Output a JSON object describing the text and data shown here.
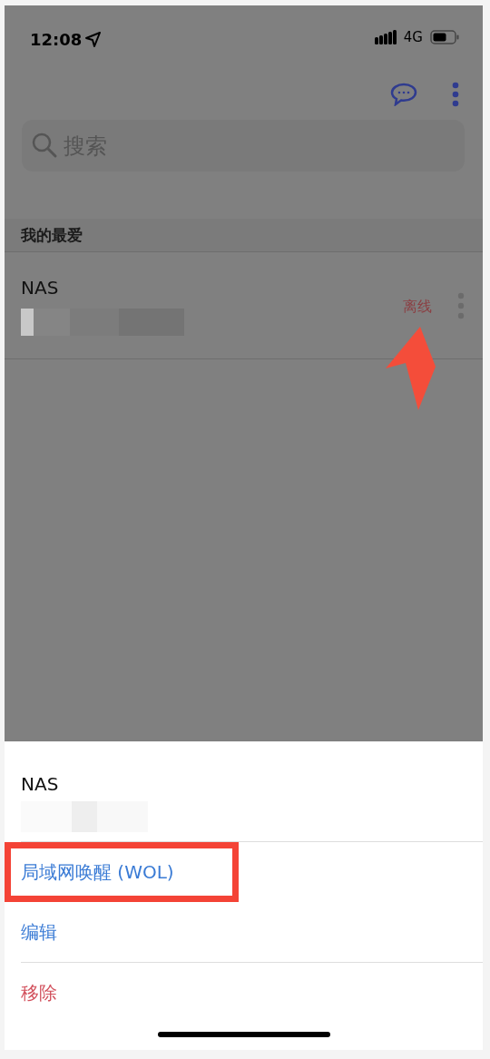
{
  "status_bar": {
    "time": "12:08",
    "network": "4G"
  },
  "search": {
    "placeholder": "搜索"
  },
  "section": {
    "title": "我的最爱"
  },
  "devices": [
    {
      "name": "NAS",
      "status": "离线",
      "status_arrow": true
    }
  ],
  "sheet": {
    "title": "NAS",
    "actions": [
      {
        "label": "局域网唤醒 (WOL)",
        "kind": "normal",
        "highlighted": true
      },
      {
        "label": "编辑",
        "kind": "normal",
        "highlighted": false
      },
      {
        "label": "移除",
        "kind": "destructive",
        "highlighted": false
      }
    ]
  }
}
